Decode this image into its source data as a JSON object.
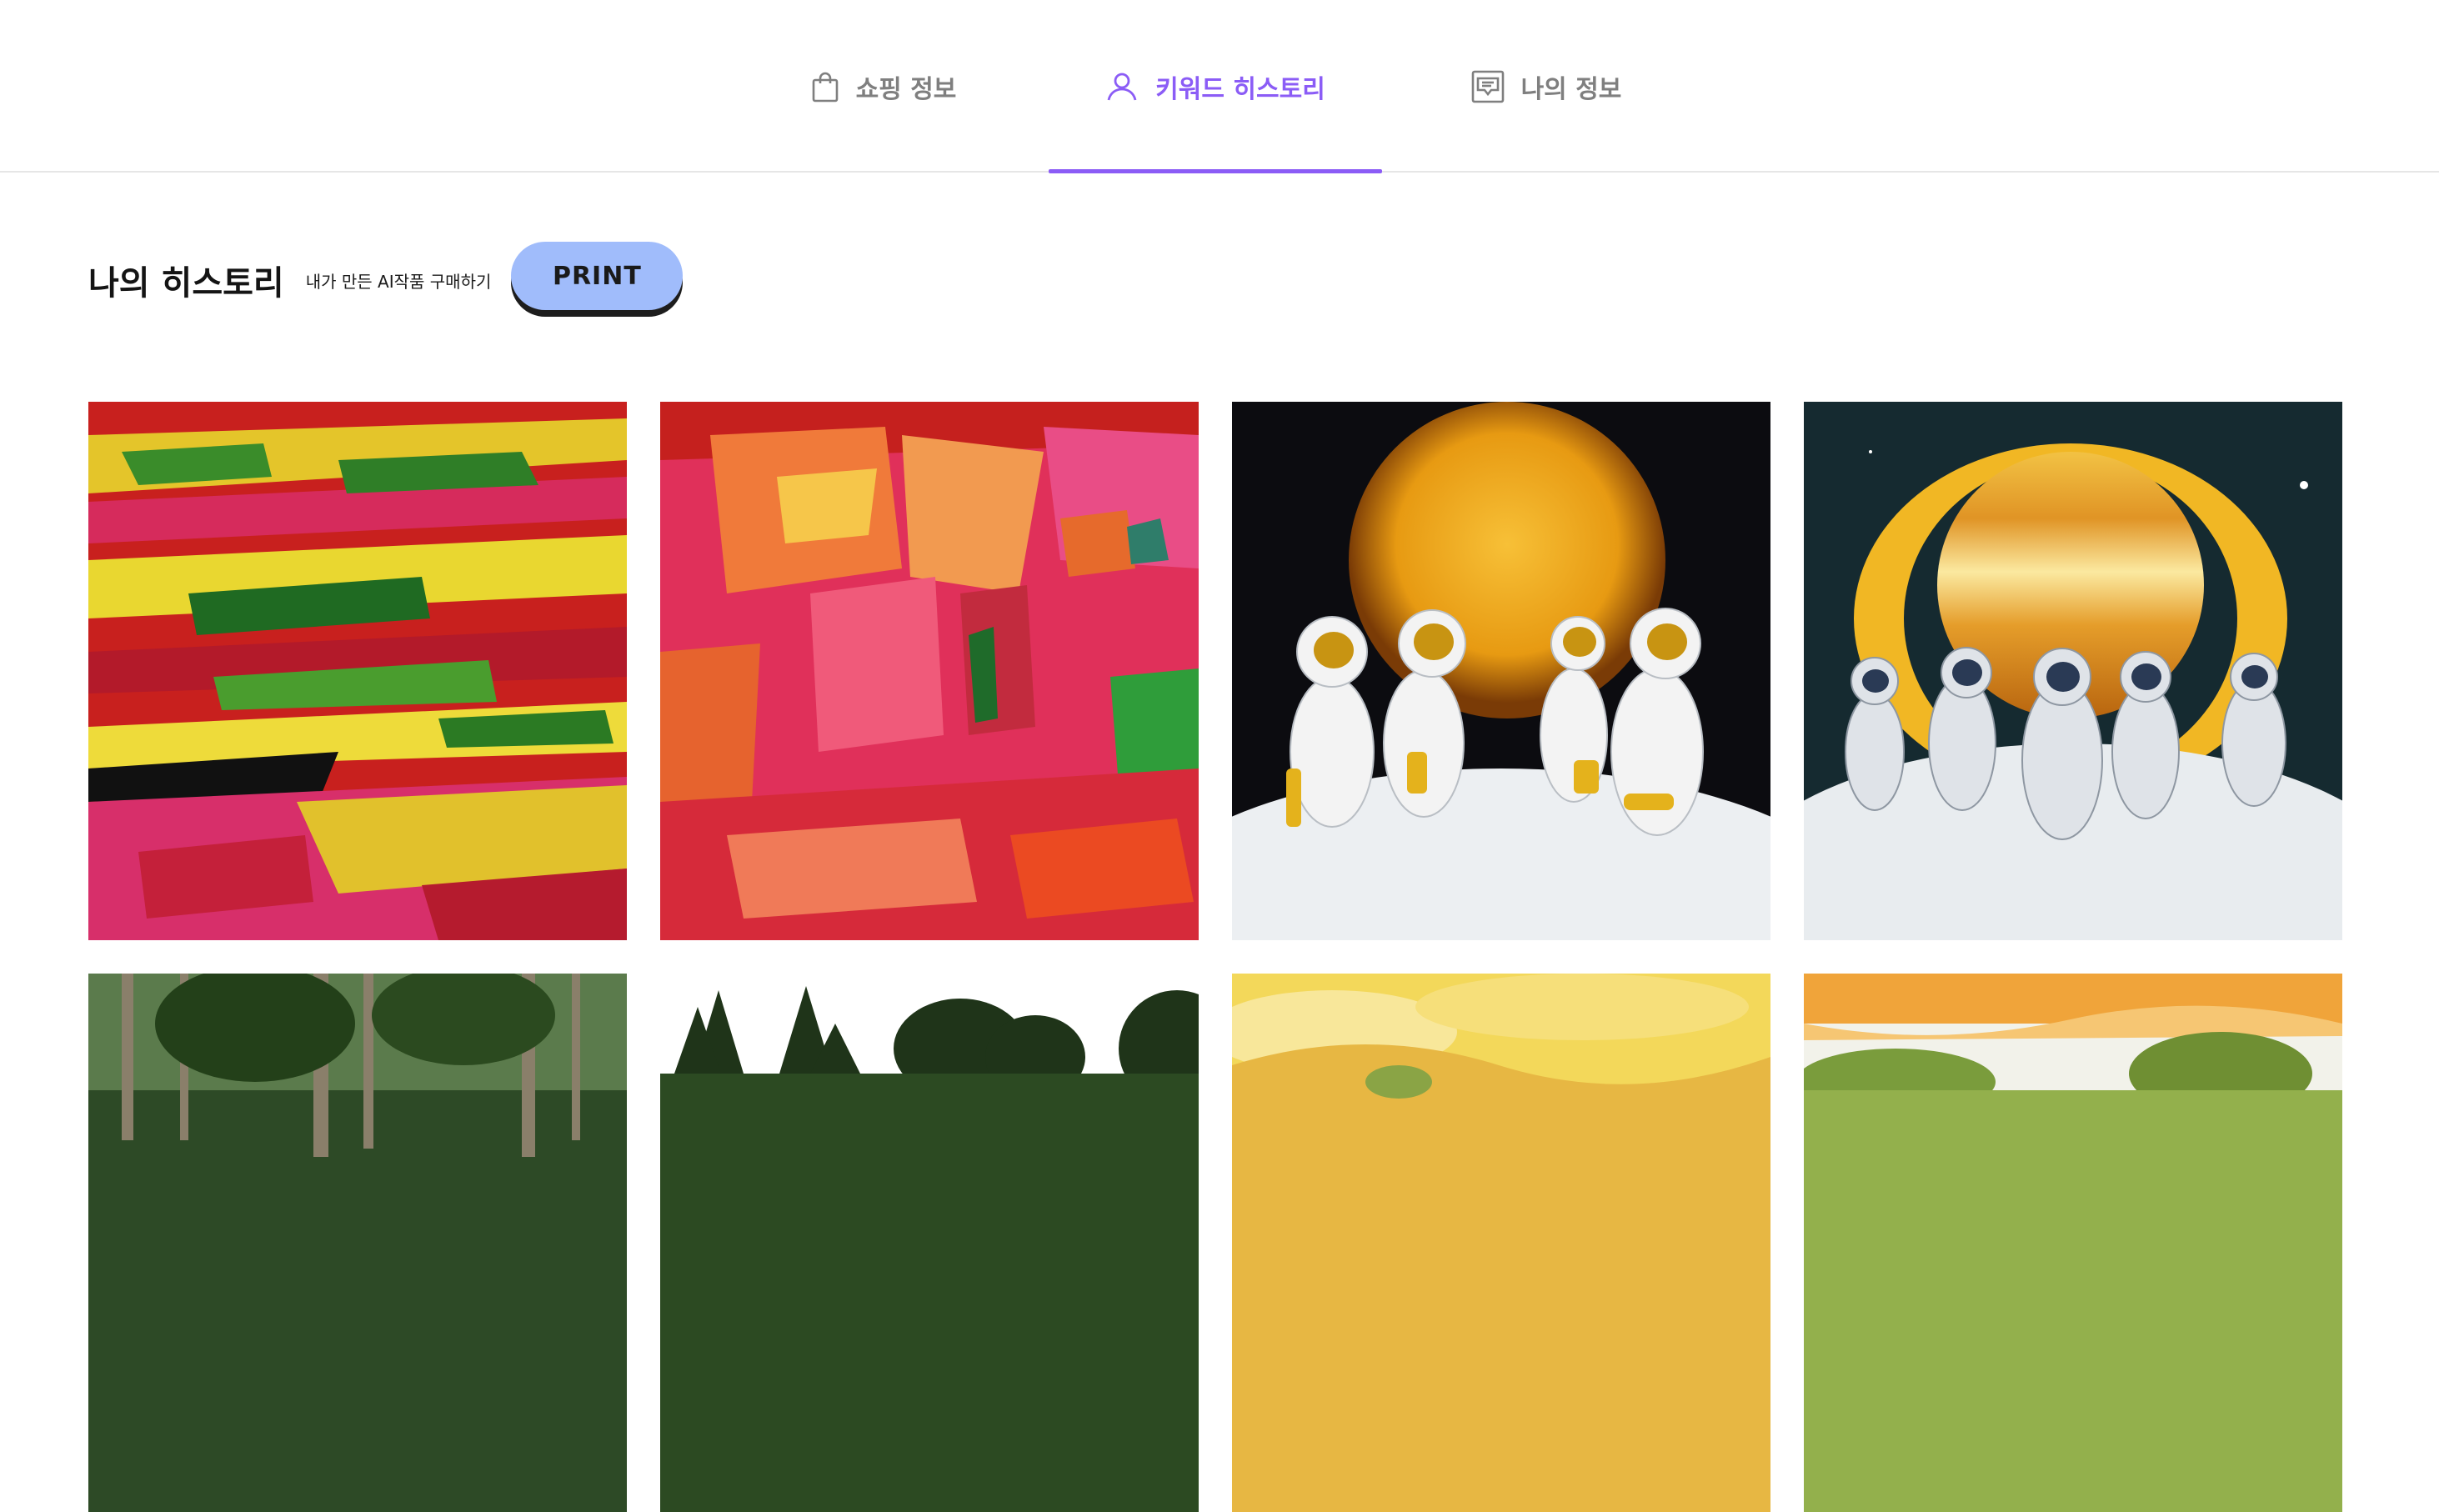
{
  "nav": {
    "tabs": [
      {
        "label": "쇼핑 정보",
        "icon": "shopping-bag-icon",
        "active": false
      },
      {
        "label": "키워드 히스토리",
        "icon": "user-icon",
        "active": true
      },
      {
        "label": "나의 정보",
        "icon": "message-box-icon",
        "active": false
      }
    ]
  },
  "history": {
    "title": "나의 히스토리",
    "subtitle": "내가 만든 AI작품 구매하기",
    "print_label": "PRINT"
  },
  "colors": {
    "accent": "#8b5cf6",
    "inactive_tab": "#7f7f7f",
    "print_button": "#a0bcfb"
  },
  "gallery": {
    "items": [
      {
        "subject": "red yellow abstract painting"
      },
      {
        "subject": "pink abstract painting"
      },
      {
        "subject": "astronauts with golden planet"
      },
      {
        "subject": "astronauts with ringed planet"
      },
      {
        "subject": "forest trees"
      },
      {
        "subject": "tree line"
      },
      {
        "subject": "yellow watercolor landscape"
      },
      {
        "subject": "orange watercolor landscape"
      }
    ]
  }
}
